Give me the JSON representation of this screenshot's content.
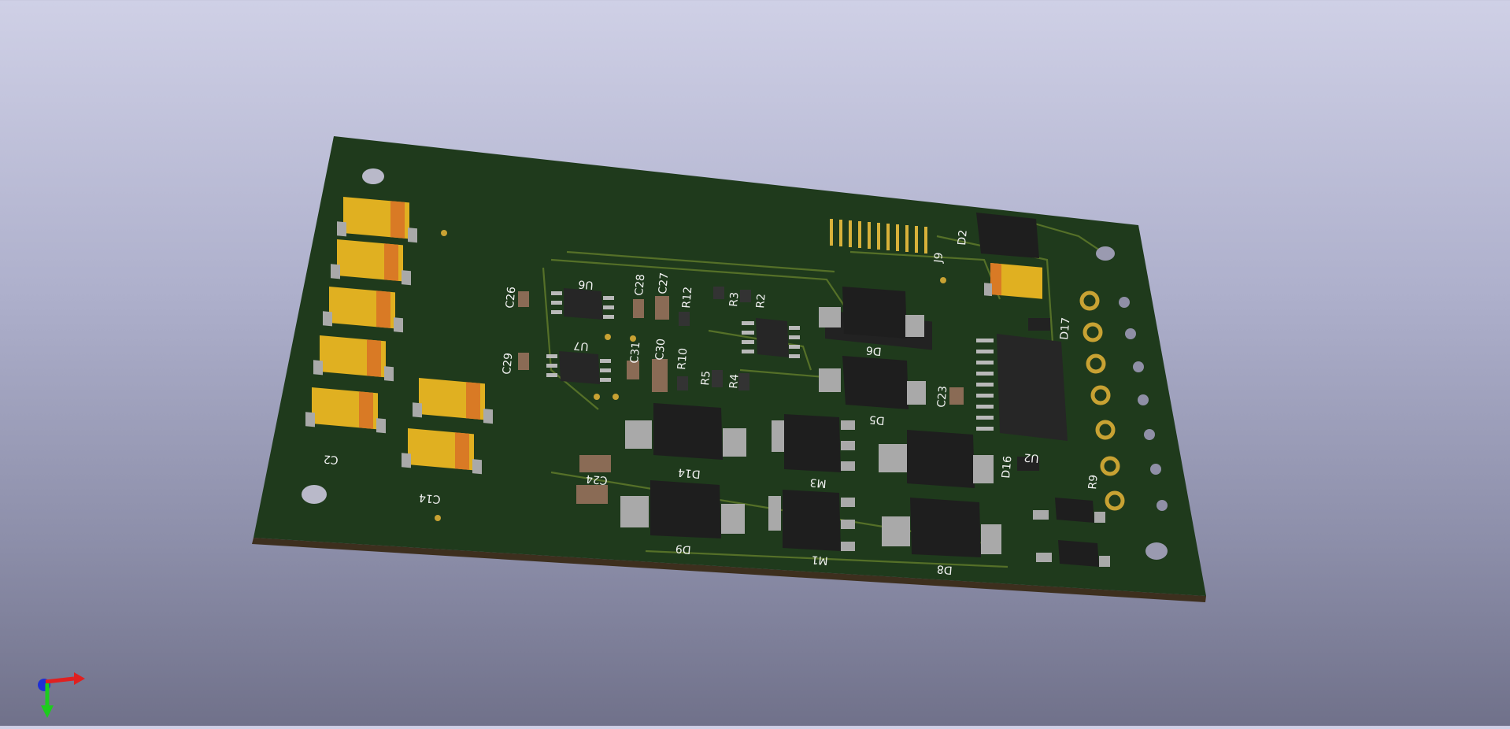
{
  "viewer": {
    "background_top": "#cfd0e6",
    "background_bottom": "#70718a",
    "board_color": "#1f3a1c",
    "pad_color": "#c8a233"
  },
  "board": {
    "labels": {
      "C2": "C2",
      "C14": "C14",
      "C26": "C26",
      "U6": "U6",
      "C28": "C28",
      "C27": "C27",
      "R12": "R12",
      "R3": "R3",
      "R2": "R2",
      "C29": "C29",
      "U7": "U7",
      "C31": "C31",
      "C30": "C30",
      "R10": "R10",
      "R5": "R5",
      "R4": "R4",
      "D6": "D6",
      "D5": "D5",
      "C23": "C23",
      "J9": "J9",
      "D2": "D2",
      "D17": "D17",
      "U2": "U2",
      "D16": "D16",
      "R9": "R9",
      "D14": "D14",
      "M3": "M3",
      "D9": "D9",
      "M1": "M1",
      "D8": "D8",
      "C24": "C24"
    }
  },
  "axes": {
    "x_icon": "x-axis-arrow-icon",
    "y_icon": "y-axis-arrow-icon",
    "z_icon": "z-axis-dot-icon"
  }
}
